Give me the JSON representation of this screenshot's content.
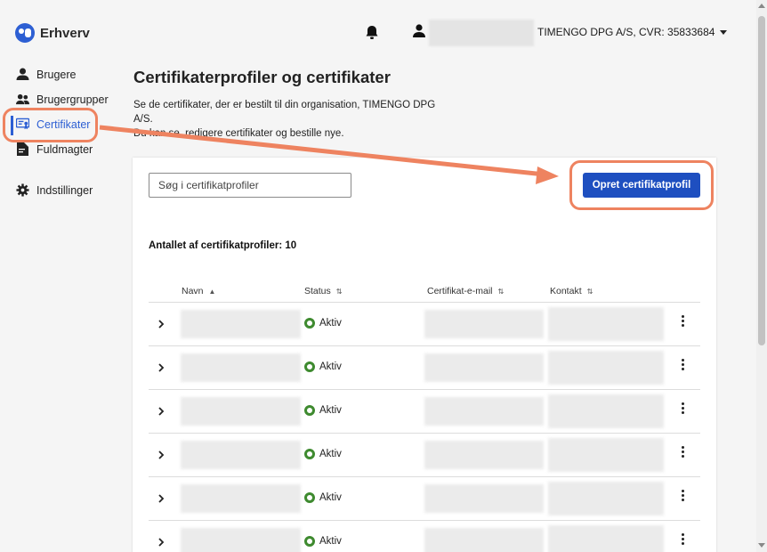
{
  "header": {
    "brand": "Erhverv",
    "organization": "TIMENGO DPG A/S, CVR: 35833684",
    "icons": {
      "notifications": "bell-icon",
      "user": "user-icon",
      "dropdown": "caret-down-icon"
    }
  },
  "sidebar": {
    "items": [
      {
        "label": "Brugere",
        "icon": "user-icon"
      },
      {
        "label": "Brugergrupper",
        "icon": "users-icon"
      },
      {
        "label": "Certifikater",
        "icon": "certificate-icon",
        "active": true
      },
      {
        "label": "Fuldmagter",
        "icon": "document-icon"
      },
      {
        "label": "Indstillinger",
        "icon": "gear-icon"
      }
    ]
  },
  "main": {
    "title": "Certifikaterprofiler og certifikater",
    "description_line1": "Se de certifikater, der er bestilt til din organisation, TIMENGO DPG",
    "description_line2": "A/S.",
    "description_line3": "Du kan se, redigere certifikater og bestille nye.",
    "search_placeholder": "Søg i certifikatprofiler",
    "create_button": "Opret certifikatprofil",
    "count_label": "Antallet af certifikatprofiler: 10",
    "table": {
      "columns": [
        "Navn",
        "Status",
        "Certifikat-e-mail",
        "Kontakt"
      ],
      "rows": [
        {
          "status": "Aktiv"
        },
        {
          "status": "Aktiv"
        },
        {
          "status": "Aktiv"
        },
        {
          "status": "Aktiv"
        },
        {
          "status": "Aktiv"
        },
        {
          "status": "Aktiv"
        }
      ]
    }
  },
  "colors": {
    "accent": "#2d5fd3",
    "button": "#1e4fc0",
    "status_active": "#3e8a2f",
    "annotation": "#ee8360"
  }
}
